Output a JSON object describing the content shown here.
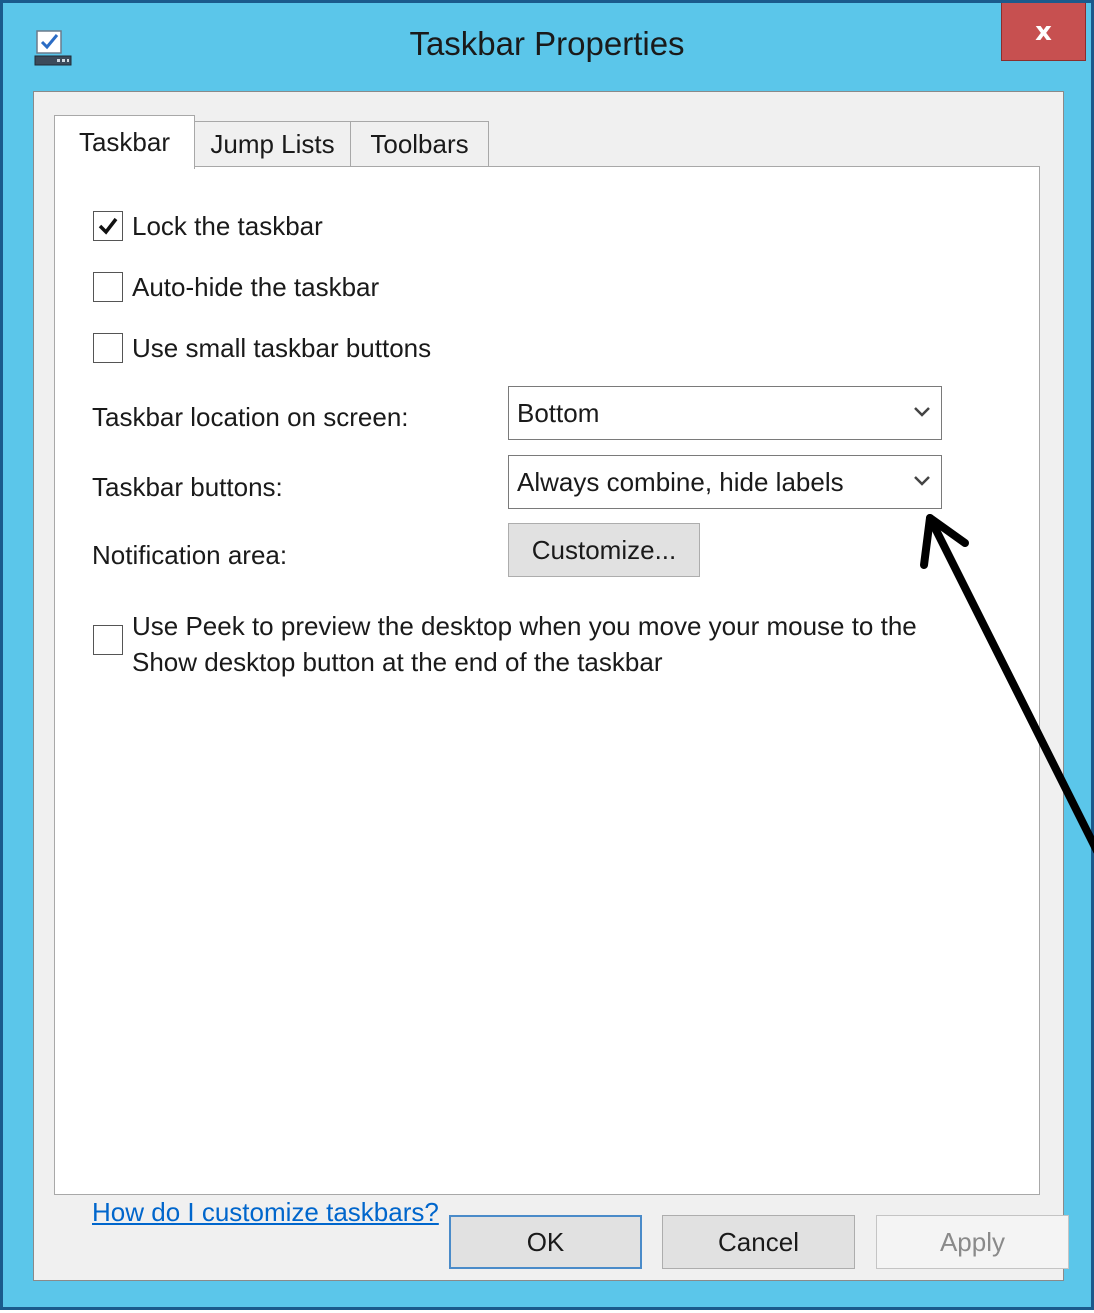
{
  "window": {
    "title": "Taskbar Properties",
    "close_label": "x",
    "icon": "taskbar-properties-icon"
  },
  "tabs": [
    {
      "label": "Taskbar",
      "active": true
    },
    {
      "label": "Jump Lists",
      "active": false
    },
    {
      "label": "Toolbars",
      "active": false
    }
  ],
  "options": {
    "lock_taskbar": {
      "label": "Lock the taskbar",
      "checked": true
    },
    "auto_hide": {
      "label": "Auto-hide the taskbar",
      "checked": false
    },
    "small_buttons": {
      "label": "Use small taskbar buttons",
      "checked": false
    },
    "peek": {
      "label_line1": "Use Peek to preview the desktop when you move your mouse to the",
      "label_line2": "Show desktop button at the end of the taskbar",
      "checked": false
    }
  },
  "location": {
    "label": "Taskbar location on screen:",
    "value": "Bottom"
  },
  "buttons_setting": {
    "label": "Taskbar buttons:",
    "value": "Always combine, hide labels"
  },
  "notification": {
    "label": "Notification area:",
    "button": "Customize..."
  },
  "help_link": "How do I customize taskbars?",
  "footer": {
    "ok": "OK",
    "cancel": "Cancel",
    "apply": "Apply"
  },
  "colors": {
    "window_frame": "#5bc6ea",
    "close_button": "#c75050",
    "link": "#0066cc",
    "annotation_arrow": "#000000"
  }
}
